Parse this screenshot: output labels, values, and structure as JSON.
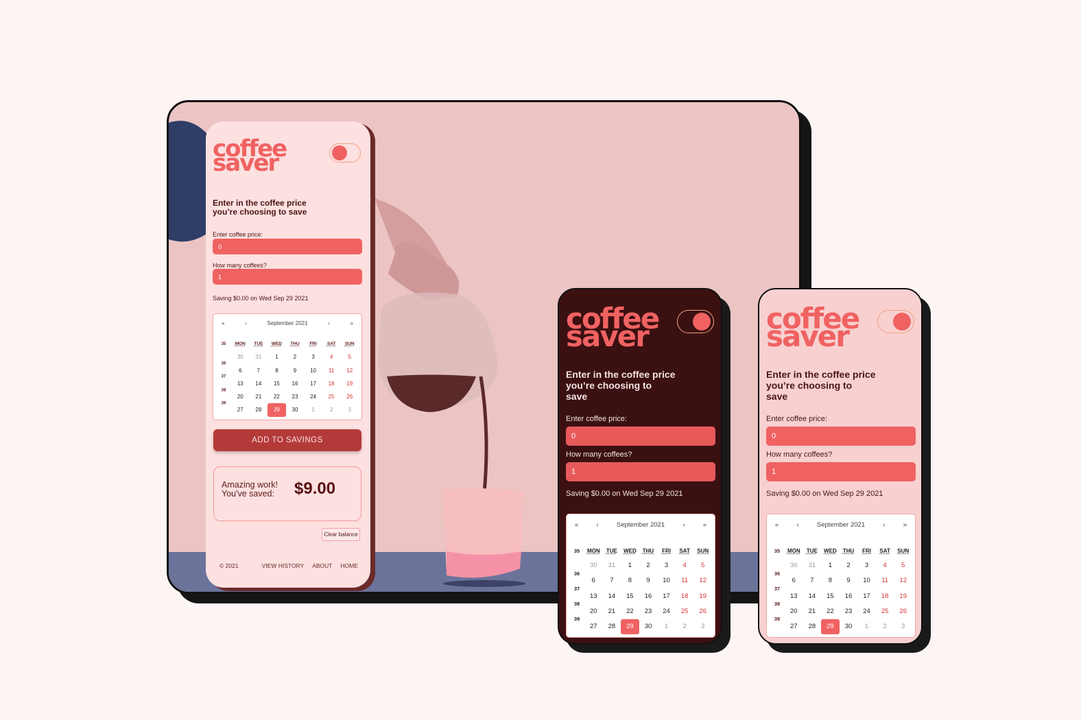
{
  "app": {
    "logo": [
      "coffee",
      "saver"
    ],
    "heading": "Enter in the coffee price you’re choosing to save",
    "price_label": "Enter coffee price:",
    "price_value": "0",
    "count_label": "How many coffees?",
    "count_value": "1",
    "saving_text": "Saving $0.00 on Wed Sep 29 2021",
    "calendar": {
      "month": "September 2021",
      "nav": {
        "prev_year": "«",
        "prev": "‹",
        "next": "›",
        "next_year": "»"
      },
      "weekdays": [
        "MON",
        "TUE",
        "WED",
        "THU",
        "FRI",
        "SAT",
        "SUN"
      ],
      "weeks": [
        "35",
        "36",
        "37",
        "38",
        "39"
      ],
      "days": [
        [
          "30",
          "31",
          "1",
          "2",
          "3",
          "4",
          "5"
        ],
        [
          "6",
          "7",
          "8",
          "9",
          "10",
          "11",
          "12"
        ],
        [
          "13",
          "14",
          "15",
          "16",
          "17",
          "18",
          "19"
        ],
        [
          "20",
          "21",
          "22",
          "23",
          "24",
          "25",
          "26"
        ],
        [
          "27",
          "28",
          "29",
          "30",
          "1",
          "2",
          "3"
        ]
      ],
      "selected": "29"
    },
    "add_button": "ADD TO SAVINGS",
    "saved_message": [
      "Amazing work!",
      "You've saved:"
    ],
    "saved_amount": "$9.00",
    "clear_button": "Clear balance",
    "footer": {
      "copyright": "© 2021",
      "links": [
        "VIEW HISTORY",
        "ABOUT",
        "HOME"
      ]
    }
  },
  "colors": {
    "accent": "#f06262",
    "dark_bg": "#3b1011",
    "light_bg": "#fde0e0",
    "button": "#b43a3a",
    "weekend": "#d93030"
  }
}
